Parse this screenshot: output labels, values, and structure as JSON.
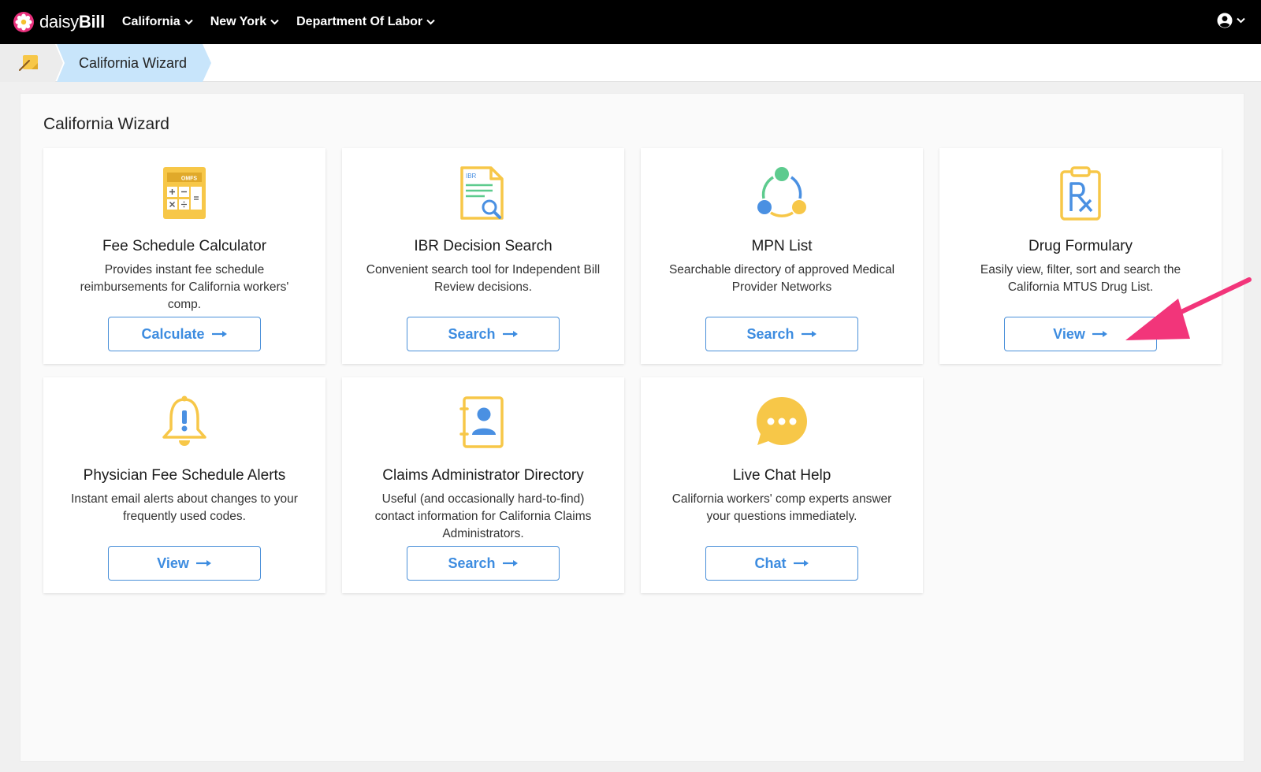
{
  "brand": {
    "name_part1": "daisy",
    "name_part2": "Bill",
    "logo_icon": "daisy-flower-icon"
  },
  "nav": {
    "items": [
      {
        "label": "California"
      },
      {
        "label": "New York"
      },
      {
        "label": "Department Of Labor"
      }
    ],
    "account_icon": "user-circle-icon"
  },
  "breadcrumb": {
    "home_icon": "sticky-note-icon",
    "current": "California Wizard"
  },
  "page": {
    "title": "California Wizard"
  },
  "cards": [
    {
      "title": "Fee Schedule Calculator",
      "description": "Provides instant fee schedule reimbursements for California workers' comp.",
      "button": "Calculate",
      "icon": "calculator-icon",
      "icon_text": "OMFS"
    },
    {
      "title": "IBR Decision Search",
      "description": "Convenient search tool for Independent Bill Review decisions.",
      "button": "Search",
      "icon": "document-search-icon",
      "icon_text": "IBR"
    },
    {
      "title": "MPN List",
      "description": "Searchable directory of approved Medical Provider Networks",
      "button": "Search",
      "icon": "network-cycle-icon"
    },
    {
      "title": "Drug Formulary",
      "description": "Easily view, filter, sort and search the California MTUS Drug List.",
      "button": "View",
      "icon": "rx-clipboard-icon"
    },
    {
      "title": "Physician Fee Schedule Alerts",
      "description": "Instant email alerts about changes to your frequently used codes.",
      "button": "View",
      "icon": "alert-bell-icon"
    },
    {
      "title": "Claims Administrator Directory",
      "description": "Useful (and occasionally hard-to-find) contact information for California Claims Administrators.",
      "button": "Search",
      "icon": "contact-book-icon"
    },
    {
      "title": "Live Chat Help",
      "description": "California workers' comp experts answer your questions immediately.",
      "button": "Chat",
      "icon": "chat-bubble-icon"
    }
  ],
  "colors": {
    "accent": "#3d8ce0",
    "icon_yellow": "#f7c748",
    "icon_blue": "#4a90e2",
    "icon_green": "#5dcb8e",
    "annotation": "#f2357a",
    "breadcrumb_active": "#c8e5fb"
  }
}
